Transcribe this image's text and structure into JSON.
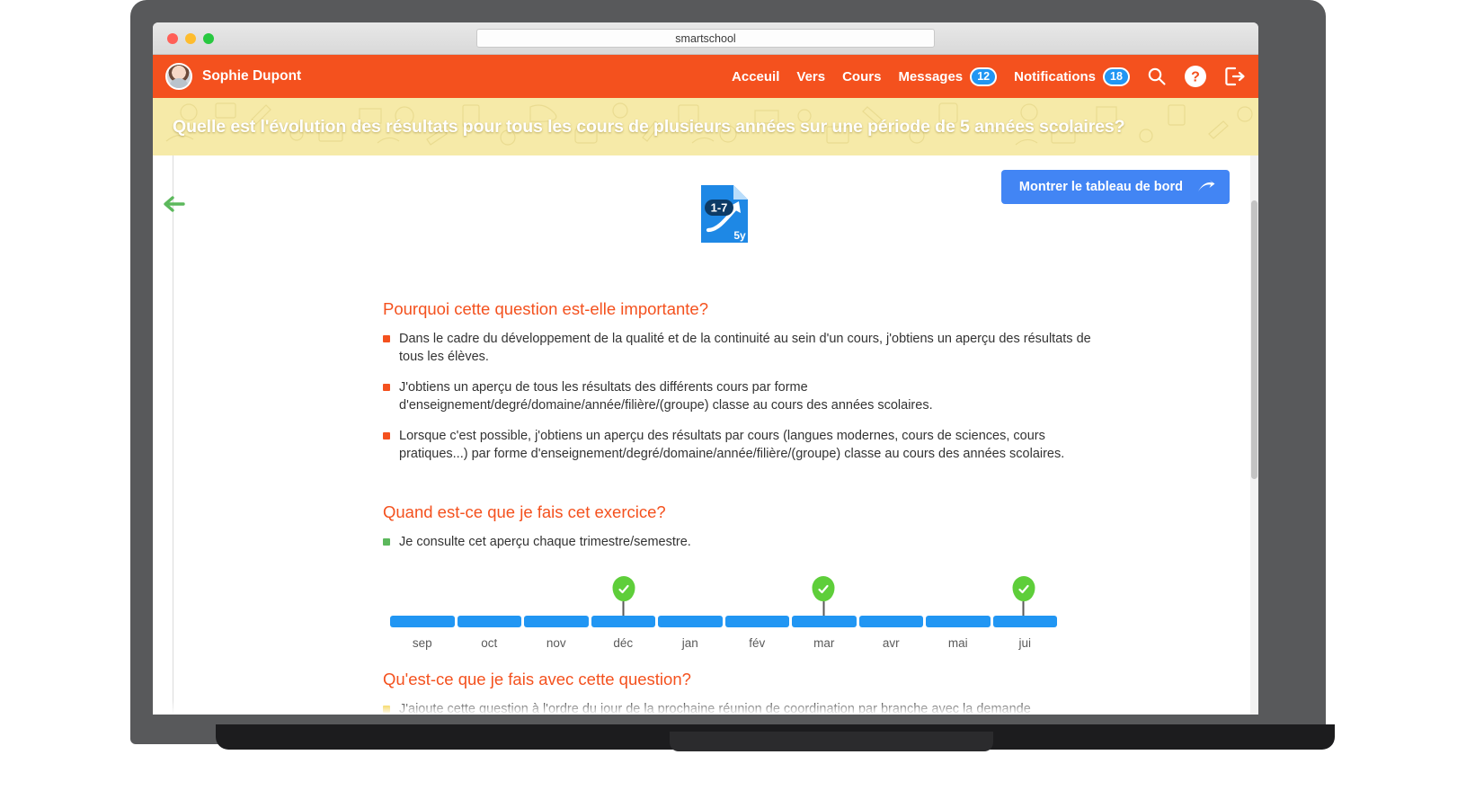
{
  "browser": {
    "url": "smartschool",
    "traffic_lights": [
      "close",
      "minimize",
      "maximize"
    ]
  },
  "header": {
    "user_name": "Sophie Dupont",
    "avatar_icon": "user-avatar",
    "nav": [
      {
        "label": "Acceuil",
        "badge": null
      },
      {
        "label": "Vers",
        "badge": null
      },
      {
        "label": "Cours",
        "badge": null
      },
      {
        "label": "Messages",
        "badge": "12"
      },
      {
        "label": "Notifications",
        "badge": "18"
      }
    ],
    "icons": [
      {
        "name": "search-icon"
      },
      {
        "name": "help-icon"
      },
      {
        "name": "logout-icon"
      }
    ],
    "accent_color": "#f4511e",
    "badge_color": "#2196f3"
  },
  "banner": {
    "title": "Quelle est l'évolution des résultats pour tous les cours de plusieurs années sur une période de 5 années scolaires?",
    "background_color": "#f6eaa8"
  },
  "toolbar": {
    "dashboard_button": "Montrer le tableau de bord",
    "dashboard_button_icon": "arrow-right-curved-icon",
    "dashboard_button_color": "#4285f4",
    "back_arrow_icon": "arrow-left-icon",
    "back_arrow_color": "#5cb85c"
  },
  "doc_icon": {
    "badge_label": "1-7",
    "years_label": "5y",
    "icon_name": "document-trend-icon",
    "color": "#1e88e5"
  },
  "sections": [
    {
      "heading": "Pourquoi cette question est-elle importante?",
      "bullet_color": "orange",
      "items": [
        "Dans le cadre du développement de la qualité et de la continuité au sein d'un cours, j'obtiens un aperçu des résultats de tous les élèves.",
        "J'obtiens un aperçu de tous les résultats des différents cours par forme d'enseignement/degré/domaine/année/filière/(groupe) classe au cours des années scolaires.",
        "Lorsque c'est possible, j'obtiens un aperçu des résultats par cours (langues modernes, cours de sciences, cours pratiques...) par forme d'enseignement/degré/domaine/année/filière/(groupe) classe au cours des années scolaires."
      ]
    },
    {
      "heading": "Quand est-ce que je fais cet exercice?",
      "bullet_color": "green",
      "items": [
        "Je consulte cet aperçu chaque trimestre/semestre."
      ]
    },
    {
      "heading": "Qu'est-ce que je fais avec cette question?",
      "bullet_color": "yellow",
      "items": [
        "J'ajoute cette question à l'ordre du jour de la prochaine réunion de coordination par branche avec la demande"
      ]
    }
  ],
  "timeline": {
    "months": [
      "sep",
      "oct",
      "nov",
      "déc",
      "jan",
      "fév",
      "mar",
      "avr",
      "mai",
      "jui"
    ],
    "marked_months": [
      "déc",
      "mar",
      "jui"
    ],
    "bar_color": "#2196f3",
    "marker_color": "#5ece3a",
    "marker_icon": "check-icon"
  }
}
